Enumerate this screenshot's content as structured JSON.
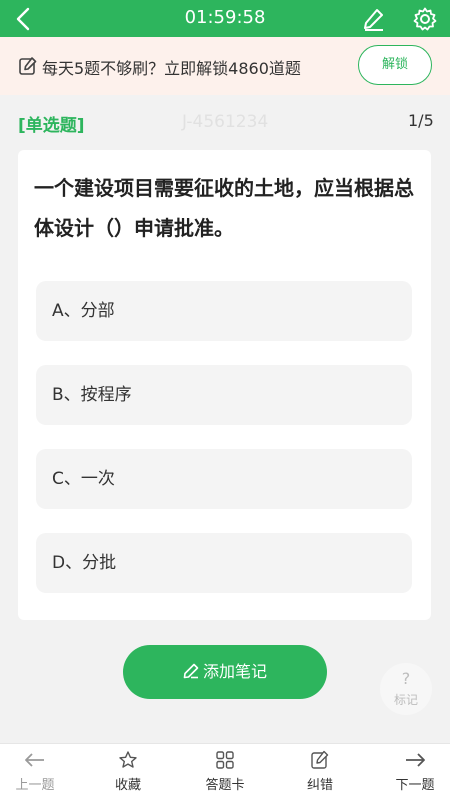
{
  "header": {
    "timer": "01:59:58",
    "icons": [
      "back-arrow-icon",
      "edit-icon",
      "gear-icon"
    ]
  },
  "banner": {
    "text": "每天5题不够刷？立即解锁4860道题",
    "unlock_label": "解锁"
  },
  "question": {
    "type_label": "[单选题]",
    "id_watermark": "J-4561234",
    "progress": "1/5",
    "text": "一个建设项目需要征收的土地，应当根据总体设计（）申请批准。",
    "options": [
      {
        "label": "A、分部"
      },
      {
        "label": "B、按程序"
      },
      {
        "label": "C、一次"
      },
      {
        "label": "D、分批"
      }
    ]
  },
  "actions": {
    "add_note_label": "添加笔记",
    "mark_symbol": "?",
    "mark_label": "标记"
  },
  "bottom_nav": {
    "prev": "上一题",
    "favorite": "收藏",
    "answer_card": "答题卡",
    "report_error": "纠错",
    "next": "下一题"
  },
  "colors": {
    "accent": "#2db55d",
    "banner_bg": "#fdf1ec",
    "page_bg": "#f2f2f2"
  }
}
